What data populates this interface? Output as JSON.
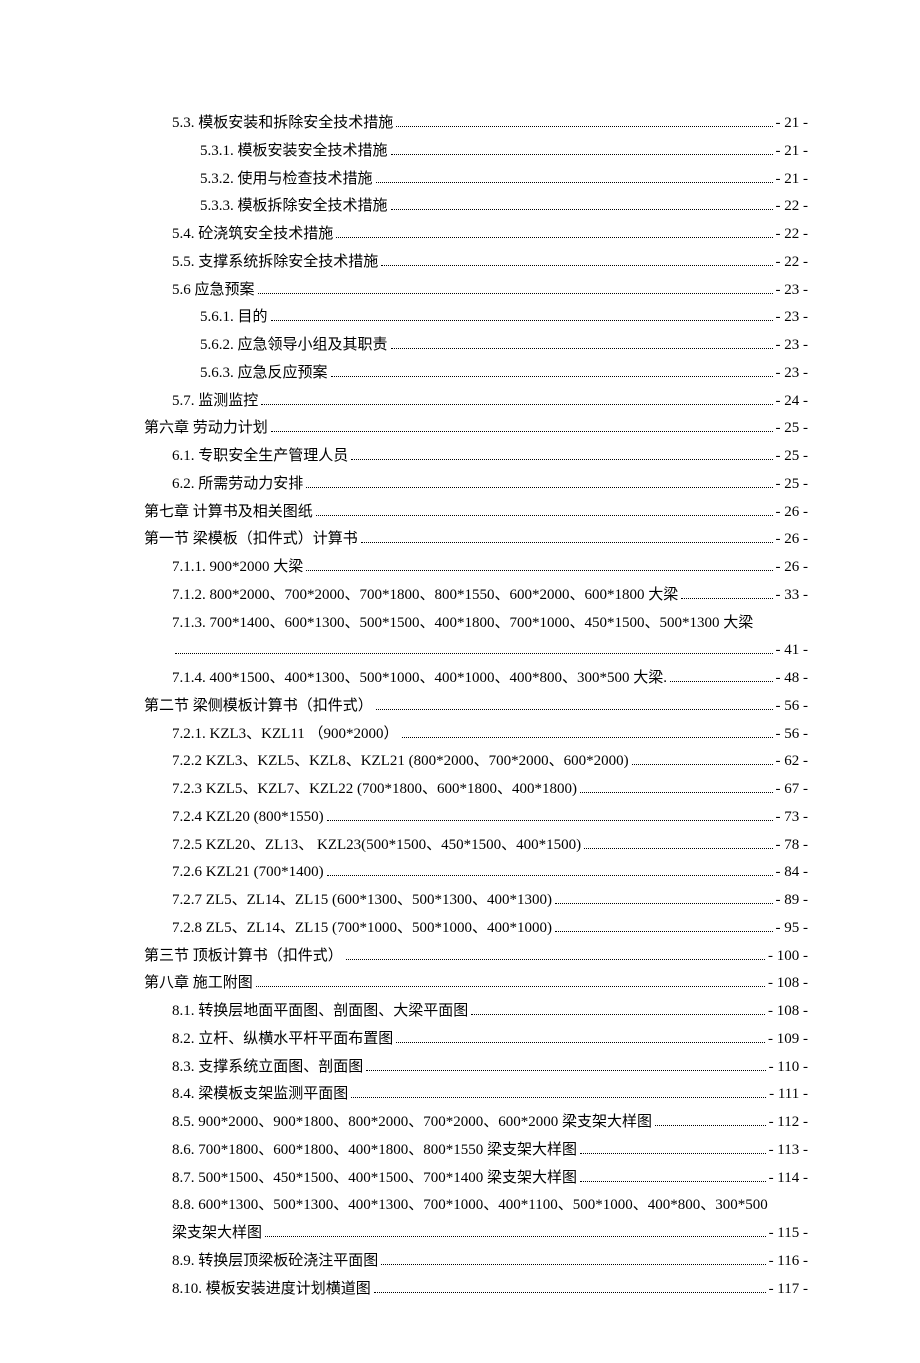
{
  "toc": [
    {
      "level": 1,
      "label": "5.3. 模板安装和拆除安全技术措施",
      "page": "- 21 -"
    },
    {
      "level": 2,
      "label": "5.3.1. 模板安装安全技术措施",
      "page": "- 21 -"
    },
    {
      "level": 2,
      "label": "5.3.2.  使用与检查技术措施",
      "page": "- 21 -"
    },
    {
      "level": 2,
      "label": "5.3.3. 模板拆除安全技术措施",
      "page": "- 22 -"
    },
    {
      "level": 1,
      "label": "5.4. 砼浇筑安全技术措施",
      "page": "- 22 -"
    },
    {
      "level": 1,
      "label": "5.5. 支撑系统拆除安全技术措施",
      "page": "- 22 -"
    },
    {
      "level": 1,
      "label": "5.6 应急预案",
      "page": "- 23 -"
    },
    {
      "level": 2,
      "label": "5.6.1. 目的",
      "page": "- 23 -"
    },
    {
      "level": 2,
      "label": "5.6.2. 应急领导小组及其职责",
      "page": "- 23 -"
    },
    {
      "level": 2,
      "label": "5.6.3. 应急反应预案",
      "page": "- 23 -"
    },
    {
      "level": 1,
      "label": "5.7. 监测监控",
      "page": "- 24 -"
    },
    {
      "level": 0,
      "label": "第六章   劳动力计划",
      "page": "- 25 -"
    },
    {
      "level": 1,
      "label": "6.1. 专职安全生产管理人员",
      "page": "- 25 -"
    },
    {
      "level": 1,
      "label": "6.2. 所需劳动力安排",
      "page": "- 25 -"
    },
    {
      "level": 0,
      "label": "第七章   计算书及相关图纸",
      "page": "- 26 -"
    },
    {
      "level": 0,
      "label": "第一节   梁模板（扣件式）计算书",
      "page": "- 26 -"
    },
    {
      "level": 1,
      "label": "7.1.1.  900*2000 大梁",
      "page": "- 26 -"
    },
    {
      "level": 1,
      "label": "7.1.2.  800*2000、700*2000、700*1800、800*1550、600*2000、600*1800 大梁",
      "page": "- 33 -"
    },
    {
      "level": 1,
      "label": "7.1.3.  700*1400、600*1300、500*1500、400*1800、700*1000、450*1500、500*1300 大梁",
      "page": "",
      "nowrap": false
    },
    {
      "level": 1,
      "label": "",
      "page": "- 41 -",
      "dotsOnly": true
    },
    {
      "level": 1,
      "label": "7.1.4.  400*1500、400*1300、500*1000、400*1000、400*800、300*500 大梁.",
      "page": "- 48 -"
    },
    {
      "level": 0,
      "label": "第二节   梁侧模板计算书（扣件式）",
      "page": "- 56 -"
    },
    {
      "level": 1,
      "label": "7.2.1. KZL3、KZL11 （900*2000）",
      "page": "- 56 -"
    },
    {
      "level": 1,
      "label": "7.2.2 KZL3、KZL5、KZL8、KZL21 (800*2000、700*2000、600*2000)",
      "page": "- 62 -"
    },
    {
      "level": 1,
      "label": "7.2.3 KZL5、KZL7、KZL22 (700*1800、600*1800、400*1800)",
      "page": "- 67 -"
    },
    {
      "level": 1,
      "label": "7.2.4 KZL20 (800*1550)",
      "page": "- 73 -"
    },
    {
      "level": 1,
      "label": "7.2.5 KZL20、ZL13、 KZL23(500*1500、450*1500、400*1500)",
      "page": "- 78 -"
    },
    {
      "level": 1,
      "label": "7.2.6 KZL21 (700*1400)",
      "page": "- 84 -"
    },
    {
      "level": 1,
      "label": "7.2.7 ZL5、ZL14、ZL15  (600*1300、500*1300、400*1300)",
      "page": "- 89 -"
    },
    {
      "level": 1,
      "label": "7.2.8 ZL5、ZL14、ZL15  (700*1000、500*1000、400*1000)",
      "page": "- 95 -"
    },
    {
      "level": 0,
      "label": "第三节   顶板计算书（扣件式）",
      "page": "- 100 -"
    },
    {
      "level": 0,
      "label": "第八章   施工附图",
      "page": "- 108 -"
    },
    {
      "level": 1,
      "label": "8.1.  转换层地面平面图、剖面图、大梁平面图",
      "page": "- 108 -"
    },
    {
      "level": 1,
      "label": "8.2.  立杆、纵横水平杆平面布置图",
      "page": "- 109 -"
    },
    {
      "level": 1,
      "label": "8.3.  支撑系统立面图、剖面图",
      "page": "- 110 -"
    },
    {
      "level": 1,
      "label": "8.4.  梁模板支架监测平面图",
      "page": "- 111 -"
    },
    {
      "level": 1,
      "label": "8.5.  900*2000、900*1800、800*2000、700*2000、600*2000 梁支架大样图",
      "page": "- 112 -"
    },
    {
      "level": 1,
      "label": "8.6.  700*1800、600*1800、400*1800、800*1550 梁支架大样图",
      "page": "- 113 -"
    },
    {
      "level": 1,
      "label": "8.7.  500*1500、450*1500、400*1500、700*1400 梁支架大样图",
      "page": "- 114 -"
    },
    {
      "level": 1,
      "label": "8.8.  600*1300、500*1300、400*1300、700*1000、400*1100、500*1000、400*800、300*500",
      "page": "",
      "nowrap": false
    },
    {
      "level": 1,
      "label": "梁支架大样图",
      "page": "- 115 -"
    },
    {
      "level": 1,
      "label": "8.9.  转换层顶梁板砼浇注平面图",
      "page": "- 116 -"
    },
    {
      "level": 1,
      "label": "8.10.  模板安装进度计划横道图",
      "page": "- 117 -"
    }
  ]
}
